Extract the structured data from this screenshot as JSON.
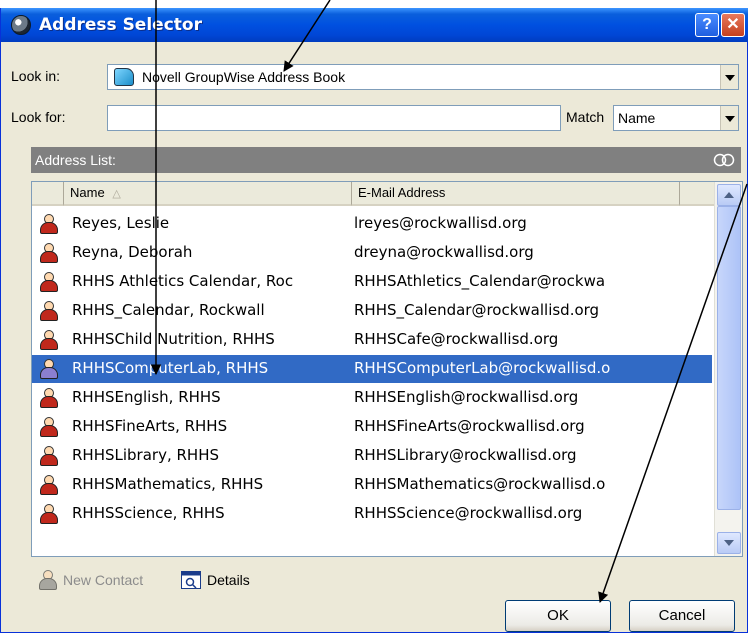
{
  "window": {
    "title": "Address Selector",
    "help_label": "?",
    "close_label": "✕"
  },
  "look_in": {
    "label": "Look in:",
    "value": "Novell GroupWise Address Book",
    "icon": "address-book-icon"
  },
  "look_for": {
    "label": "Look for:",
    "value": "",
    "match_label": "Match",
    "match_value": "Name"
  },
  "address_list": {
    "label": "Address List:",
    "columns": [
      "Name",
      "E-Mail Address"
    ],
    "sort_indicator": "△",
    "rows": [
      {
        "name": "Reyes, Leslie",
        "email": "lreyes@rockwallisd.org",
        "selected": false
      },
      {
        "name": "Reyna, Deborah",
        "email": "dreyna@rockwallisd.org",
        "selected": false
      },
      {
        "name": "RHHS Athletics Calendar, Roc",
        "email": "RHHSAthletics_Calendar@rockwa",
        "selected": false
      },
      {
        "name": "RHHS_Calendar, Rockwall",
        "email": "RHHS_Calendar@rockwallisd.org",
        "selected": false
      },
      {
        "name": "RHHSChild Nutrition, RHHS",
        "email": "RHHSCafe@rockwallisd.org",
        "selected": false
      },
      {
        "name": "RHHSComputerLab, RHHS",
        "email": "RHHSComputerLab@rockwallisd.o",
        "selected": true
      },
      {
        "name": "RHHSEnglish, RHHS",
        "email": "RHHSEnglish@rockwallisd.org",
        "selected": false
      },
      {
        "name": "RHHSFineArts, RHHS",
        "email": "RHHSFineArts@rockwallisd.org",
        "selected": false
      },
      {
        "name": "RHHSLibrary, RHHS",
        "email": "RHHSLibrary@rockwallisd.org",
        "selected": false
      },
      {
        "name": "RHHSMathematics, RHHS",
        "email": "RHHSMathematics@rockwallisd.o",
        "selected": false
      },
      {
        "name": "RHHSScience, RHHS",
        "email": "RHHSScience@rockwallisd.org",
        "selected": false
      }
    ]
  },
  "actions": {
    "new_contact": "New Contact",
    "details": "Details",
    "ok": "OK",
    "cancel": "Cancel"
  },
  "colors": {
    "title_blue": "#0050e0",
    "selection": "#316ac5",
    "dialog_bg": "#ece9d8"
  }
}
